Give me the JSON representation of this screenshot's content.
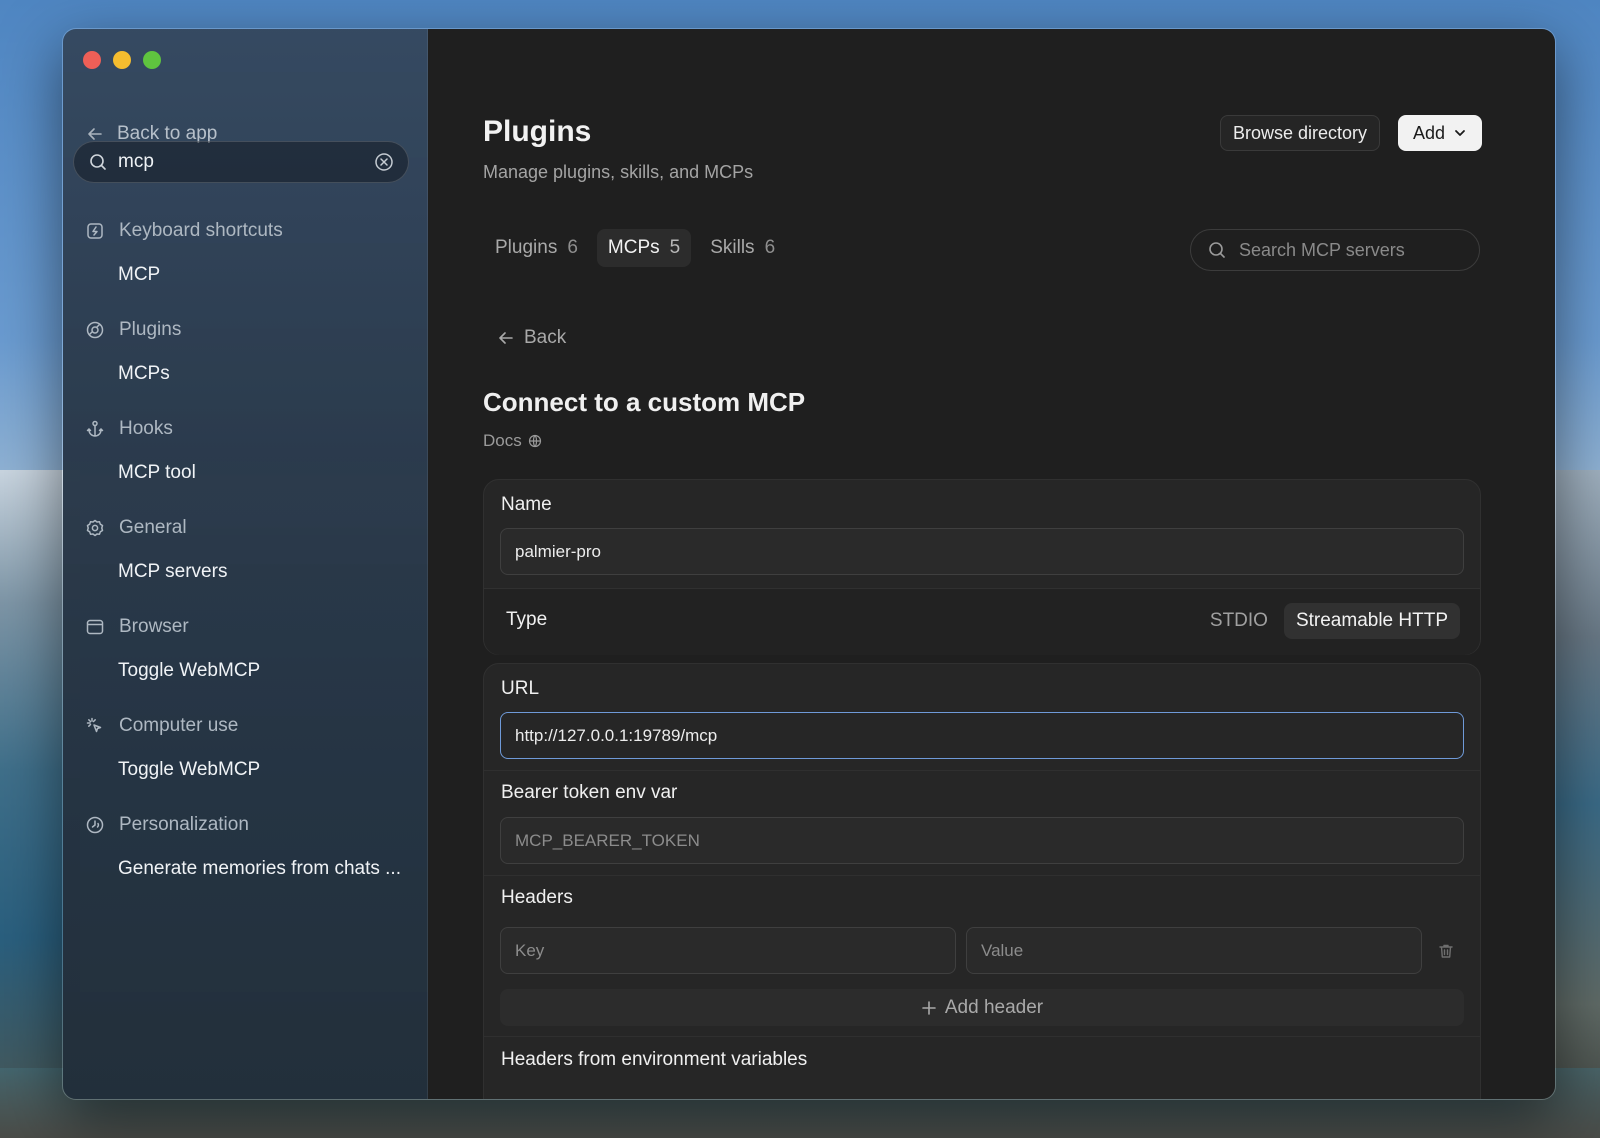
{
  "sidebar": {
    "back_label": "Back to app",
    "search_value": "mcp",
    "sections": [
      {
        "label": "Keyboard shortcuts",
        "icon": "keyboard-shortcut-icon",
        "child": "MCP"
      },
      {
        "label": "Plugins",
        "icon": "plugins-icon",
        "child": "MCPs"
      },
      {
        "label": "Hooks",
        "icon": "anchor-icon",
        "child": "MCP tool"
      },
      {
        "label": "General",
        "icon": "gear-icon",
        "child": "MCP servers"
      },
      {
        "label": "Browser",
        "icon": "browser-window-icon",
        "child": "Toggle WebMCP"
      },
      {
        "label": "Computer use",
        "icon": "cursor-click-icon",
        "child": "Toggle WebMCP"
      },
      {
        "label": "Personalization",
        "icon": "personalization-icon",
        "child": "Generate memories from chats ..."
      }
    ]
  },
  "header": {
    "title": "Plugins",
    "subtitle": "Manage plugins, skills, and MCPs",
    "browse_label": "Browse directory",
    "add_label": "Add"
  },
  "tabs": [
    {
      "label": "Plugins",
      "count": "6",
      "active": false
    },
    {
      "label": "MCPs",
      "count": "5",
      "active": true
    },
    {
      "label": "Skills",
      "count": "6",
      "active": false
    }
  ],
  "search_mcp": {
    "placeholder": "Search MCP servers"
  },
  "form": {
    "back_label": "Back",
    "title": "Connect to a custom MCP",
    "docs_label": "Docs",
    "name_label": "Name",
    "name_value": "palmier-pro",
    "type_label": "Type",
    "type_options": [
      "STDIO",
      "Streamable HTTP"
    ],
    "type_selected": "Streamable HTTP",
    "url_label": "URL",
    "url_value": "http://127.0.0.1:19789/mcp",
    "bearer_label": "Bearer token env var",
    "bearer_placeholder": "MCP_BEARER_TOKEN",
    "headers_label": "Headers",
    "key_placeholder": "Key",
    "value_placeholder": "Value",
    "add_header_label": "Add header",
    "env_headers_label": "Headers from environment variables"
  },
  "colors": {
    "accent_focus": "#6f9ad8",
    "traffic_red": "#ee5f57",
    "traffic_yellow": "#f5bd2f",
    "traffic_green": "#5fc43f"
  }
}
